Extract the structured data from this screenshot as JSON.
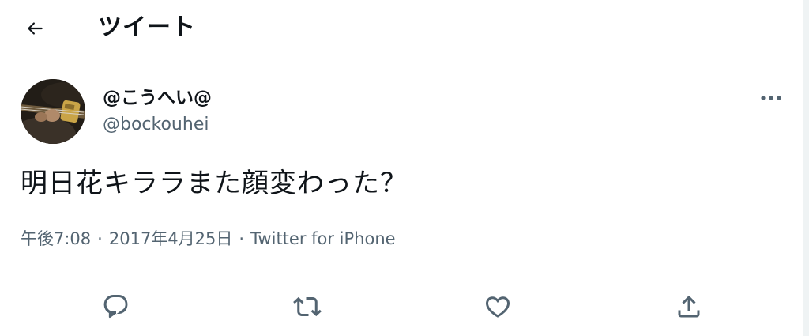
{
  "header": {
    "back_icon": "arrow-left-icon",
    "title": "ツイート"
  },
  "tweet": {
    "author": {
      "display_name": "@こうへい@",
      "handle": "@bockouhei",
      "avatar": "guitar-photo"
    },
    "more_icon": "more-horizontal-icon",
    "text": "明日花キララまた顔変わった？",
    "meta": {
      "time": "午後7:08",
      "separator": "·",
      "date": "2017年4月25日",
      "source": "Twitter for iPhone"
    },
    "actions": [
      {
        "name": "reply",
        "icon": "reply-icon"
      },
      {
        "name": "retweet",
        "icon": "retweet-icon"
      },
      {
        "name": "like",
        "icon": "heart-icon"
      },
      {
        "name": "share",
        "icon": "share-icon"
      }
    ]
  },
  "colors": {
    "text_primary": "#0f1419",
    "text_secondary": "#536471",
    "divider": "#eff3f4",
    "background": "#ffffff"
  }
}
